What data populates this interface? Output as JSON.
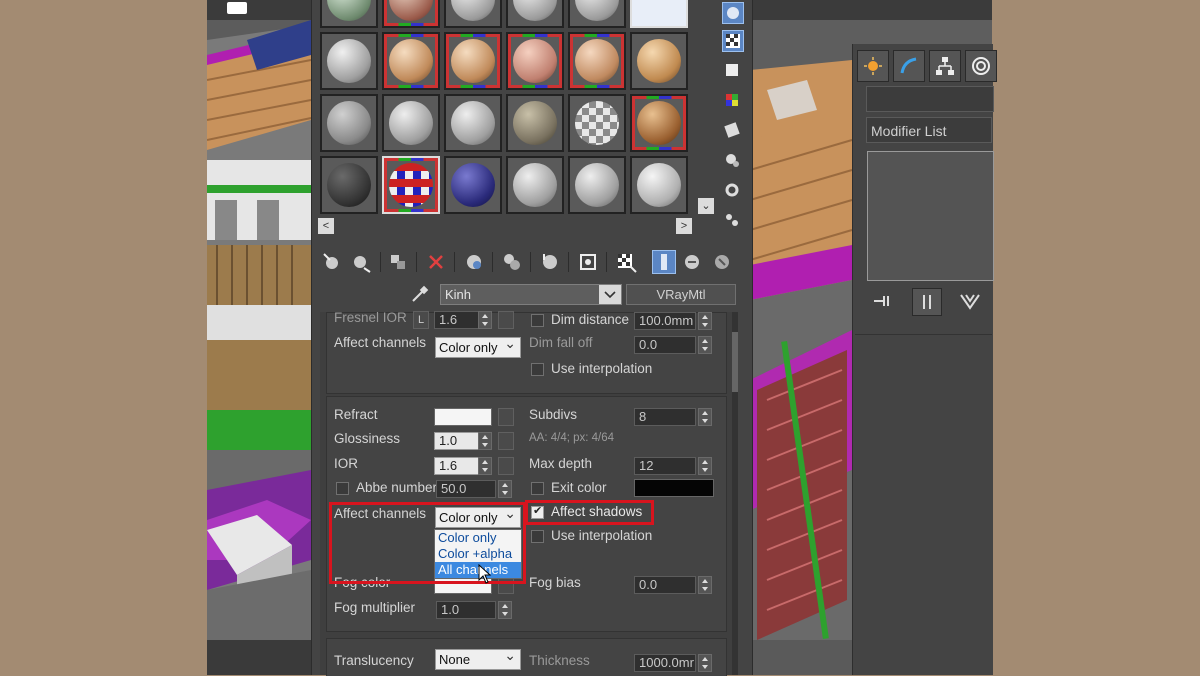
{
  "material_editor": {
    "material_name": "Kinh",
    "material_type": "VRayMtl"
  },
  "reflection_section": {
    "fresnel_ior_label": "Fresnel IOR",
    "fresnel_ior_lock": "L",
    "fresnel_ior_value": "1.6",
    "dim_distance_label": "Dim distance",
    "dim_distance_value": "100.0mm",
    "dim_fall_off_label": "Dim fall off",
    "dim_fall_off_value": "0.0",
    "affect_channels_label": "Affect channels",
    "affect_channels_value": "Color only",
    "use_interpolation_label": "Use interpolation"
  },
  "refraction_section": {
    "refract_label": "Refract",
    "subdivs_label": "Subdivs",
    "subdivs_value": "8",
    "glossiness_label": "Glossiness",
    "glossiness_value": "1.0",
    "aa_info": "AA: 4/4; px: 4/64",
    "ior_label": "IOR",
    "ior_value": "1.6",
    "max_depth_label": "Max depth",
    "max_depth_value": "12",
    "abbe_number_label": "Abbe number",
    "abbe_number_value": "50.0",
    "exit_color_label": "Exit color",
    "affect_channels_label": "Affect channels",
    "affect_channels_value": "Color only",
    "affect_channels_options": [
      "Color only",
      "Color +alpha",
      "All channels"
    ],
    "affect_shadows_label": "Affect shadows",
    "affect_shadows_checked": true,
    "use_interpolation_label": "Use interpolation",
    "fog_color_label": "Fog color",
    "fog_bias_label": "Fog bias",
    "fog_bias_value": "0.0",
    "fog_multiplier_label": "Fog multiplier",
    "fog_multiplier_value": "1.0"
  },
  "translucency_section": {
    "translucency_label": "Translucency",
    "translucency_value": "None",
    "thickness_label": "Thickness",
    "thickness_value": "1000.0mr"
  },
  "command_panel": {
    "modifier_list_label": "Modifier List"
  },
  "colors": {
    "highlight_red": "#d8141e",
    "selection_blue": "#3c89e0",
    "panel_bg": "#444444"
  }
}
